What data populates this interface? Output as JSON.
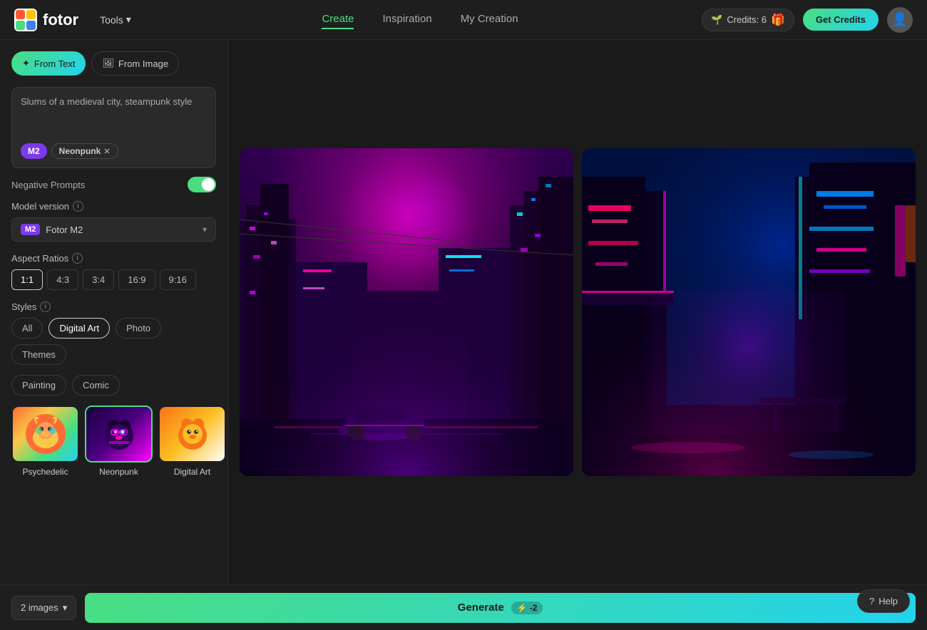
{
  "header": {
    "logo_text": "fotor",
    "tools_label": "Tools",
    "nav": [
      {
        "label": "Create",
        "active": true
      },
      {
        "label": "Inspiration",
        "active": false
      },
      {
        "label": "My Creation",
        "active": false
      }
    ],
    "credits_label": "Credits: 6",
    "get_credits_label": "Get Credits"
  },
  "tabs": [
    {
      "label": "From Text",
      "active": true,
      "icon": "✦"
    },
    {
      "label": "From Image",
      "active": false,
      "icon": "🖼"
    }
  ],
  "prompt": {
    "text": "Slums of a medieval city, steampunk style",
    "tags": [
      {
        "label": "M2",
        "type": "m2"
      },
      {
        "label": "Neonpunk",
        "type": "neonpunk"
      }
    ]
  },
  "negative_prompts": {
    "label": "Negative Prompts",
    "enabled": true
  },
  "model": {
    "label": "Model version",
    "badge": "M2",
    "name": "Fotor M2"
  },
  "aspect_ratios": {
    "label": "Aspect Ratios",
    "options": [
      "1:1",
      "4:3",
      "3:4",
      "16:9",
      "9:16"
    ],
    "selected": "1:1"
  },
  "styles": {
    "label": "Styles",
    "filters": [
      "All",
      "Digital Art",
      "Photo",
      "Themes",
      "Painting",
      "Comic"
    ],
    "selected_filter": "Digital Art",
    "thumbnails": [
      {
        "label": "Psychedelic",
        "type": "psychedelic"
      },
      {
        "label": "Neonpunk",
        "type": "neonpunk",
        "selected": true
      },
      {
        "label": "Digital Art",
        "type": "digitalart"
      }
    ]
  },
  "footer": {
    "images_label": "2 images",
    "generate_label": "Generate",
    "credit_cost": "-2"
  },
  "help": {
    "label": "Help"
  }
}
